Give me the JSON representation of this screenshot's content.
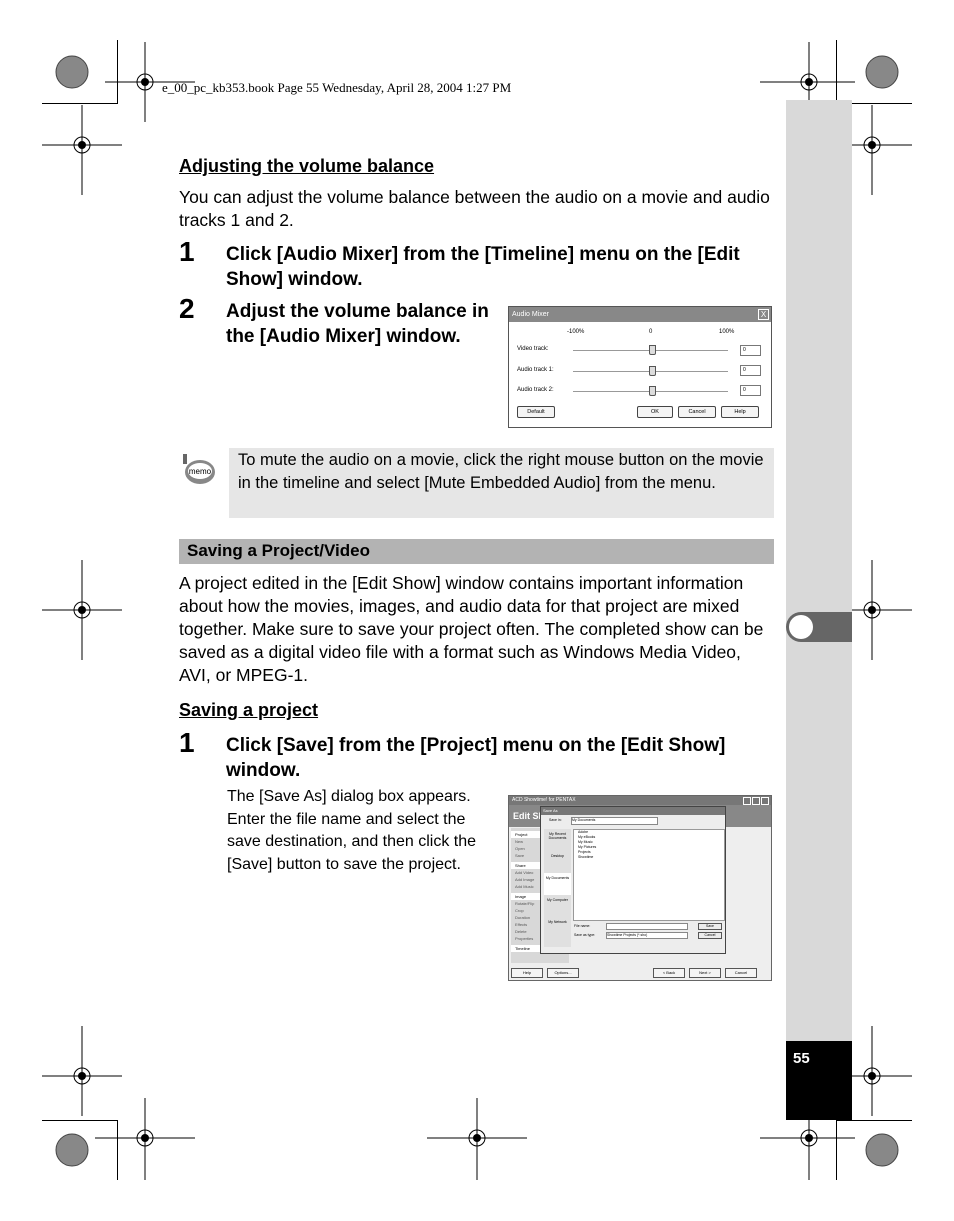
{
  "header": {
    "print_info": "e_00_pc_kb353.book  Page 55  Wednesday, April 28, 2004  1:27 PM"
  },
  "page_number": "55",
  "section_volume": {
    "heading": "Adjusting the volume balance",
    "intro": "You can adjust the volume balance between the audio on a movie and audio tracks 1 and 2.",
    "steps": [
      {
        "num": "1",
        "text": "Click [Audio Mixer] from the [Timeline] menu on the [Edit Show] window."
      },
      {
        "num": "2",
        "text": "Adjust the volume balance in the [Audio Mixer] window."
      }
    ]
  },
  "audio_mixer": {
    "title": "Audio Mixer",
    "close": "X",
    "scale": [
      "-100%",
      "0",
      "100%"
    ],
    "tracks": [
      {
        "label": "Video track:",
        "value": "0",
        "position_percent": 0
      },
      {
        "label": "Audio track 1:",
        "value": "0",
        "position_percent": 0
      },
      {
        "label": "Audio track 2:",
        "value": "0",
        "position_percent": 0
      }
    ],
    "buttons": {
      "default": "Default",
      "ok": "OK",
      "cancel": "Cancel",
      "help": "Help"
    }
  },
  "memo": {
    "icon": "memo-icon",
    "label": "memo",
    "text": "To mute the audio on a movie, click the right mouse button on the movie in the timeline and select [Mute Embedded Audio] from the menu."
  },
  "section_saving": {
    "heading": "Saving a Project/Video",
    "intro": "A project edited in the [Edit Show] window contains important information about how the movies, images, and audio data for that project are mixed together. Make sure to save your project often. The completed show can be saved as a digital video file with a format such as Windows Media Video, AVI, or MPEG-1.",
    "subheading": "Saving a project",
    "step": {
      "num": "1",
      "text": "Click [Save] from the [Project] menu on the [Edit Show] window."
    },
    "step_note": "The [Save As] dialog box appears. Enter the file name and select the save destination, and then click the [Save] button to save the project."
  },
  "acd_window": {
    "title": "ACD Showtime! for PENTAX",
    "header": "Edit Show",
    "left_panel": {
      "project_label": "Project",
      "project_items": [
        "New",
        "Open",
        "Save"
      ],
      "share_label": "Share",
      "share_items": [
        "Add Video",
        "Add Image",
        "Add Music"
      ],
      "image_label": "Image",
      "image_items": [
        "Rotate/Flip",
        "Crop",
        "Duration",
        "Effects",
        "Delete",
        "Properties"
      ],
      "timeline_label": "Timeline"
    },
    "bottom_buttons": [
      "Help",
      "Options...",
      "< Back",
      "Next >",
      "Cancel"
    ],
    "save_as": {
      "title": "Save As",
      "save_in_label": "Save in:",
      "save_in_value": "My Documents",
      "places": [
        "My Recent Documents",
        "Desktop",
        "My Documents",
        "My Computer",
        "My Network"
      ],
      "files": [
        "Adobe",
        "My eBooks",
        "My Music",
        "My Pictures",
        "Projects",
        "Showtime"
      ],
      "file_name_label": "File name:",
      "file_name_value": "",
      "save_type_label": "Save as type:",
      "save_type_value": "Showtime Projects (*.sho)",
      "save_button": "Save",
      "cancel_button": "Cancel"
    }
  }
}
